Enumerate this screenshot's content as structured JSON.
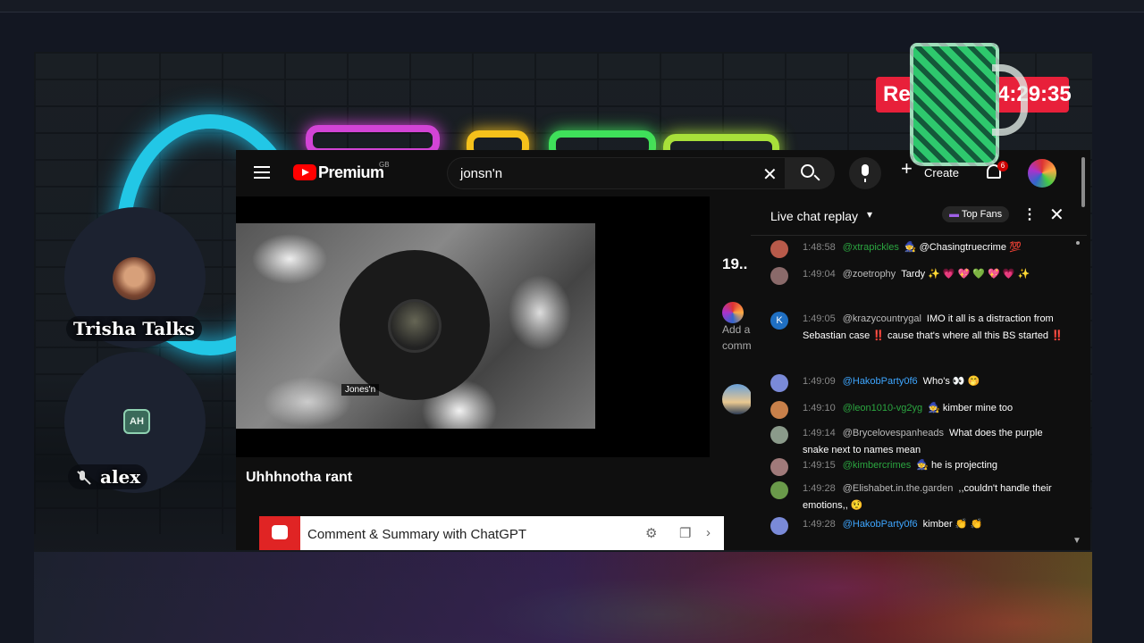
{
  "speakers": [
    {
      "name": "Trisha Talks"
    },
    {
      "name": "alex",
      "avatar_text": "AH",
      "mic_state": "muted"
    }
  ],
  "recording": {
    "label": "Rec",
    "time": "4:29:35"
  },
  "youtube": {
    "brand": "Premium",
    "region": "GB",
    "search_value": "jonsn'n",
    "create_label": "Create",
    "notification_count": "6",
    "video": {
      "title": "Uhhhnotha rant",
      "channel_label": "Jones'n"
    },
    "sidebar": {
      "count_text": "19..",
      "line1": "Add a",
      "line2": "comm"
    },
    "gpt_bar": {
      "label": "Comment & Summary with ChatGPT"
    },
    "chat": {
      "title": "Live chat replay",
      "top_fans": "Top Fans",
      "messages": [
        {
          "time": "1:48:58",
          "author": "@xtrapickles",
          "author_color": "green",
          "text": "🧙 @Chasingtruecrime 💯",
          "avatar_color": "#b85a4a"
        },
        {
          "time": "1:49:04",
          "author": "@zoetrophy",
          "author_color": "grey",
          "text": "Tardy ✨ 💗 💖 💚 💖 💗 ✨",
          "avatar_color": "#8a6a6a"
        },
        {
          "time": "1:49:05",
          "author": "@krazycountrygal",
          "author_color": "grey",
          "text": "IMO it all is a distraction from Sebastian case ‼️ cause that's where all this BS started ‼️",
          "avatar_color": "#1f6fc2",
          "avatar_text": "K"
        },
        {
          "time": "1:49:09",
          "author": "@HakobParty0f6",
          "author_color": "blue",
          "text": "Who's 👀 🤭",
          "avatar_color": "#7a8ad8"
        },
        {
          "time": "1:49:10",
          "author": "@leon1010-vg2yg",
          "author_color": "green",
          "text": "🧙 kimber mine too",
          "avatar_color": "#c8804a"
        },
        {
          "time": "1:49:14",
          "author": "@Brycelovespanheads",
          "author_color": "grey",
          "text": "What does the purple snake next to names mean",
          "avatar_color": "#8a9a8a"
        },
        {
          "time": "1:49:15",
          "author": "@kimbercrimes",
          "author_color": "green",
          "text": "🧙 he is projecting",
          "avatar_color": "#a07a7a"
        },
        {
          "time": "1:49:28",
          "author": "@Elishabet.in.the.garden",
          "author_color": "grey",
          "text": ",,couldn't handle their emotions,, 🤨",
          "avatar_color": "#6a9a4a"
        },
        {
          "time": "1:49:28",
          "author": "@HakobParty0f6",
          "author_color": "blue",
          "text": "kimber 👏 👏",
          "avatar_color": "#7a8ad8"
        }
      ]
    }
  },
  "colors": {
    "accent_red": "#ff0000",
    "rec_red": "#e8203a",
    "neon_cyan": "#22c7e6"
  }
}
